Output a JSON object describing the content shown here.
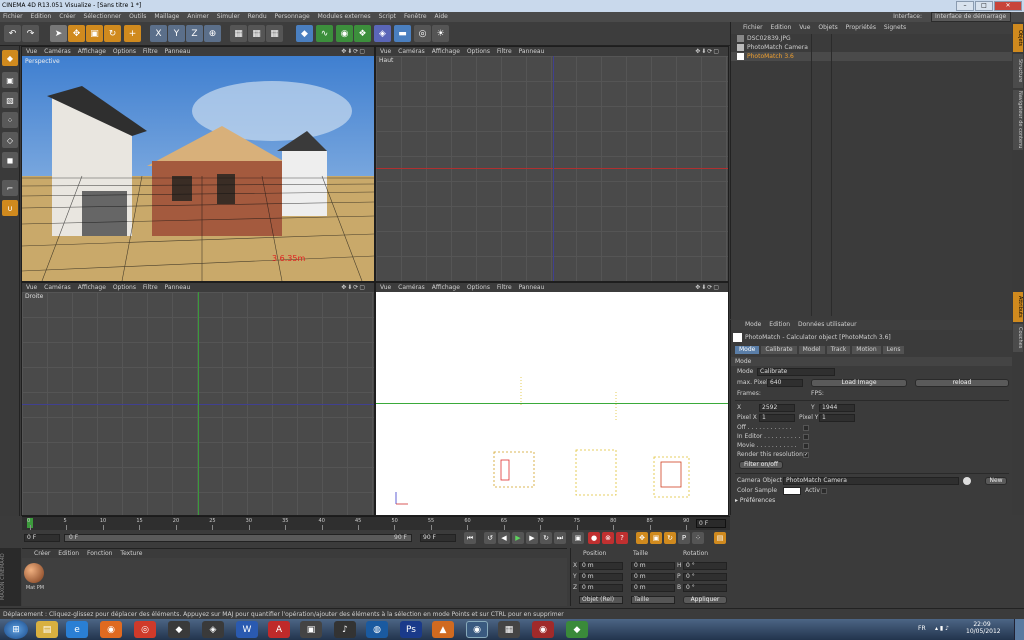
{
  "window": {
    "title": "CINEMA 4D R13.051 Visualize - [Sans titre 1 *]"
  },
  "menubar": {
    "items": [
      "Fichier",
      "Edition",
      "Créer",
      "Sélectionner",
      "Outils",
      "Maillage",
      "Animer",
      "Simuler",
      "Rendu",
      "Personnage",
      "Modules externes",
      "Script",
      "Fenêtre",
      "Aide"
    ],
    "interface_label": "Interface:",
    "interface_value": "Interface de démarrage"
  },
  "viewport_menu": [
    "Vue",
    "Caméras",
    "Affichage",
    "Options",
    "Filtre",
    "Panneau"
  ],
  "viewports": {
    "perspective": "Perspective",
    "top": "Haut",
    "right": "Droite",
    "photo_overlay": "3   6.35m"
  },
  "objects_panel": {
    "menu": [
      "Fichier",
      "Edition",
      "Vue",
      "Objets",
      "Propriétés",
      "Signets"
    ],
    "items": [
      "DSC02839.JPG",
      "PhotoMatch Camera",
      "PhotoMatch 3.6"
    ]
  },
  "attributes": {
    "menu": [
      "Mode",
      "Edition",
      "Données utilisateur"
    ],
    "title": "PhotoMatch - Calculator object [PhotoMatch 3.6]",
    "tabs": [
      "Mode",
      "Calibrate",
      "Model",
      "Track",
      "Motion",
      "Lens"
    ],
    "section": "Mode",
    "mode_label": "Mode",
    "mode_value": "Calibrate",
    "maxpixel_label": "max. Pixel",
    "maxpixel_value": "640",
    "load_image": "Load Image",
    "reload": "reload",
    "frames_label": "Frames:",
    "fps_label": "FPS:",
    "x_label": "X",
    "x_value": "2592",
    "y_label": "Y",
    "y_value": "1944",
    "pixelx_label": "Pixel X",
    "pixelx_value": "1",
    "pixely_label": "Pixel Y",
    "pixely_value": "1",
    "off_label": "Off . . . . . . . . . . . .",
    "in_editor_label": "In Editor . . . . . . . . . .",
    "movie_label": "Movie . . . . . . . . . . .",
    "render_res_label": "Render this resolution",
    "filter_btn": "Filter on/off",
    "camera_object_label": "Camera Object",
    "camera_object_value": "PhotoMatch Camera",
    "new_btn": "New",
    "color_sample_label": "Color Sample",
    "activ_label": "Activ",
    "preferences": "Préférences"
  },
  "sidetabs": [
    "Objets",
    "Structure",
    "Navigateur de contenu",
    "Couches",
    "Attributs"
  ],
  "timeline": {
    "ticks": [
      "0",
      "5",
      "10",
      "15",
      "20",
      "25",
      "30",
      "35",
      "40",
      "45",
      "50",
      "55",
      "60",
      "65",
      "70",
      "75",
      "80",
      "85",
      "90"
    ],
    "end_frame": "0 F"
  },
  "playbar": {
    "current": "0 F",
    "field": "0 F",
    "end": "90 F",
    "field_end": "90 F"
  },
  "materials": {
    "menu": [
      "Créer",
      "Edition",
      "Fonction",
      "Texture"
    ],
    "material_name": "Mat PM"
  },
  "coords": {
    "headers": [
      "Position",
      "Taille",
      "Rotation"
    ],
    "rows": [
      {
        "axis": "X",
        "pos": "0 m",
        "size": "0 m",
        "rot_label": "H",
        "rot": "0 °"
      },
      {
        "axis": "Y",
        "pos": "0 m",
        "size": "0 m",
        "rot_label": "P",
        "rot": "0 °"
      },
      {
        "axis": "Z",
        "pos": "0 m",
        "size": "0 m",
        "rot_label": "B",
        "rot": "0 °"
      }
    ],
    "object_mode": "Objet (Rel)",
    "size_mode": "Taille",
    "apply": "Appliquer"
  },
  "status": "Déplacement : Cliquez-glissez pour déplacer des éléments. Appuyez sur MAJ pour quantifier l'opération/ajouter des éléments à la sélection en mode Points et sur CTRL pour en supprimer",
  "taskbar": {
    "lang": "FR",
    "time": "22:09",
    "date": "10/05/2012"
  }
}
